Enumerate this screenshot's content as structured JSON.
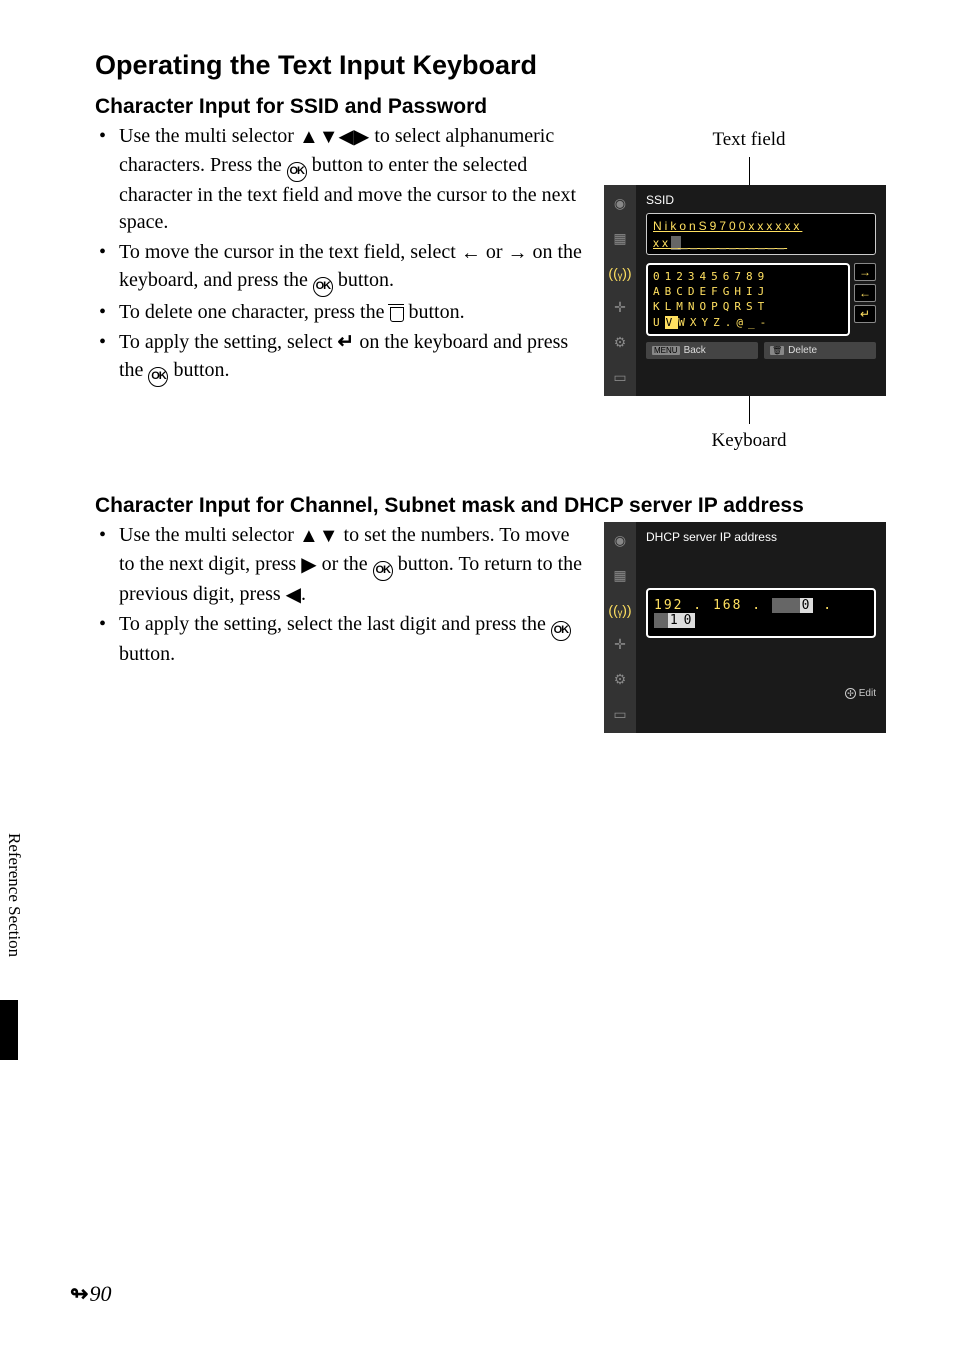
{
  "heading": "Operating the Text Input Keyboard",
  "sec1": {
    "title": "Character Input for SSID and Password",
    "b1a": "Use the multi selector ",
    "b1b": " to select alphanumeric characters. Press the ",
    "b1c": " button to enter the selected character in the text field and move the cursor to the next space.",
    "b2a": "To move the cursor in the text field, select ",
    "b2b": " or ",
    "b2c": " on the keyboard, and press the ",
    "b2d": " button.",
    "b3a": "To delete one character, press the ",
    "b3b": " button.",
    "b4a": "To apply the setting, select ",
    "b4b": " on the keyboard and press the ",
    "b4c": " button."
  },
  "fig1": {
    "label_top": "Text field",
    "label_bottom": "Keyboard",
    "screen_title": "SSID",
    "text_line1": "NikonS9700xxxxxx",
    "text_line2": "xx",
    "kbd_r1": "0123456789",
    "kbd_r2": "ABCDEFGHIJ",
    "kbd_r3": "KLMNOPQRST",
    "kbd_r4a": "U",
    "kbd_r4b": "V",
    "kbd_r4c": "WXYZ.@_-",
    "back": "Back",
    "delete": "Delete"
  },
  "sec2": {
    "title": "Character Input for Channel, Subnet mask and DHCP server IP address",
    "b1a": "Use the multi selector ",
    "b1b": " to set the numbers. To move to the next digit, press ",
    "b1c": " or the ",
    "b1d": " button. To return to the previous digit, press ",
    "b1e": ".",
    "b2a": "To apply the setting, select the last digit and press the ",
    "b2b": " button."
  },
  "fig2": {
    "screen_title": "DHCP server IP address",
    "ip_a": "192",
    "ip_b": "168",
    "edit": "Edit"
  },
  "side": "Reference Section",
  "page": "90"
}
